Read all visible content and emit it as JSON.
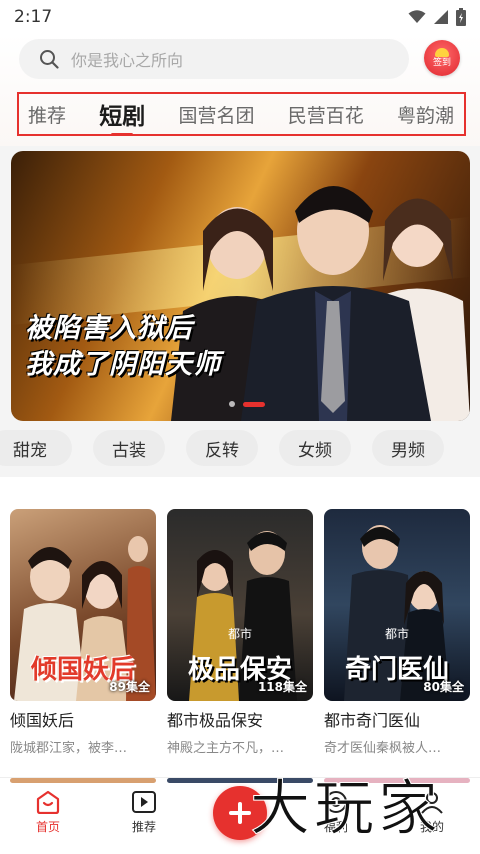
{
  "status_bar": {
    "time": "2:17"
  },
  "search": {
    "placeholder": "你是我心之所向",
    "checkin_label": "签到"
  },
  "tabs": [
    {
      "label": "推荐",
      "active": false
    },
    {
      "label": "短剧",
      "active": true
    },
    {
      "label": "国营名团",
      "active": false
    },
    {
      "label": "民营百花",
      "active": false
    },
    {
      "label": "粤韵潮",
      "active": false
    }
  ],
  "banner": {
    "title_line1": "被陷害入狱后",
    "title_line2": "我成了阴阳天师",
    "slide_count": 2,
    "active_slide": 1
  },
  "chips": [
    "甜宠",
    "古装",
    "反转",
    "女频",
    "男频"
  ],
  "cards": [
    {
      "title": "倾国妖后",
      "poster_text": "倾国妖后",
      "poster_tag": "",
      "episodes": "89集全",
      "desc": "陇城郡江家，被李…"
    },
    {
      "title": "都市极品保安",
      "poster_text": "极品保安",
      "poster_tag": "都市",
      "episodes": "118集全",
      "desc": "神殿之主方不凡，…"
    },
    {
      "title": "都市奇门医仙",
      "poster_text": "奇门医仙",
      "poster_tag": "都市",
      "episodes": "80集全",
      "desc": "奇才医仙秦枫被人…"
    }
  ],
  "bottom_nav": [
    {
      "label": "首页",
      "icon": "home-icon",
      "active": true
    },
    {
      "label": "推荐",
      "icon": "play-square-icon",
      "active": false
    },
    {
      "label": "福利",
      "icon": "gift-icon",
      "active": false
    },
    {
      "label": "我的",
      "icon": "user-icon",
      "active": false
    }
  ],
  "watermark": "大玩家",
  "colors": {
    "accent": "#e6312e",
    "chip_bg": "#ececec",
    "page_bg": "#f4f4f4"
  }
}
